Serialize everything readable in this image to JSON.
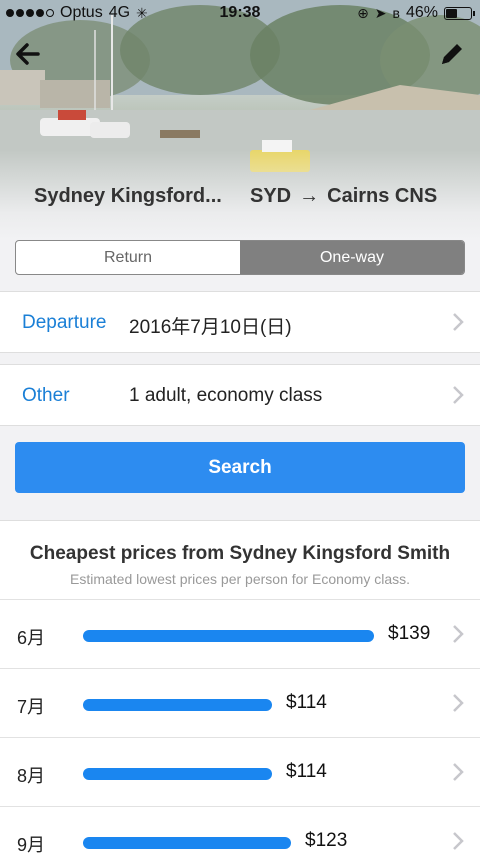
{
  "status": {
    "carrier": "Optus",
    "network": "4G",
    "time": "19:38",
    "battery": "46%"
  },
  "header": {
    "from": "Sydney Kingsford...",
    "to_code_from": "SYD",
    "arrow": "→",
    "to": "Cairns CNS"
  },
  "trip_type": {
    "return_label": "Return",
    "oneway_label": "One-way",
    "selected": "One-way"
  },
  "departure": {
    "label": "Departure",
    "value": "2016年7月10日(日)"
  },
  "other": {
    "label": "Other",
    "value": "1 adult, economy class"
  },
  "search": {
    "label": "Search"
  },
  "cheapest": {
    "title": "Cheapest prices from Sydney Kingsford Smith",
    "subtitle": "Estimated lowest prices per person for Economy class.",
    "rows": [
      {
        "month": "6月",
        "price": "$139",
        "value": 139
      },
      {
        "month": "7月",
        "price": "$114",
        "value": 114
      },
      {
        "month": "8月",
        "price": "$114",
        "value": 114
      },
      {
        "month": "9月",
        "price": "$123",
        "value": 123
      }
    ]
  },
  "colors": {
    "accent": "#2d8cf0",
    "link": "#1a7fd6",
    "bar": "#1a86f0"
  }
}
